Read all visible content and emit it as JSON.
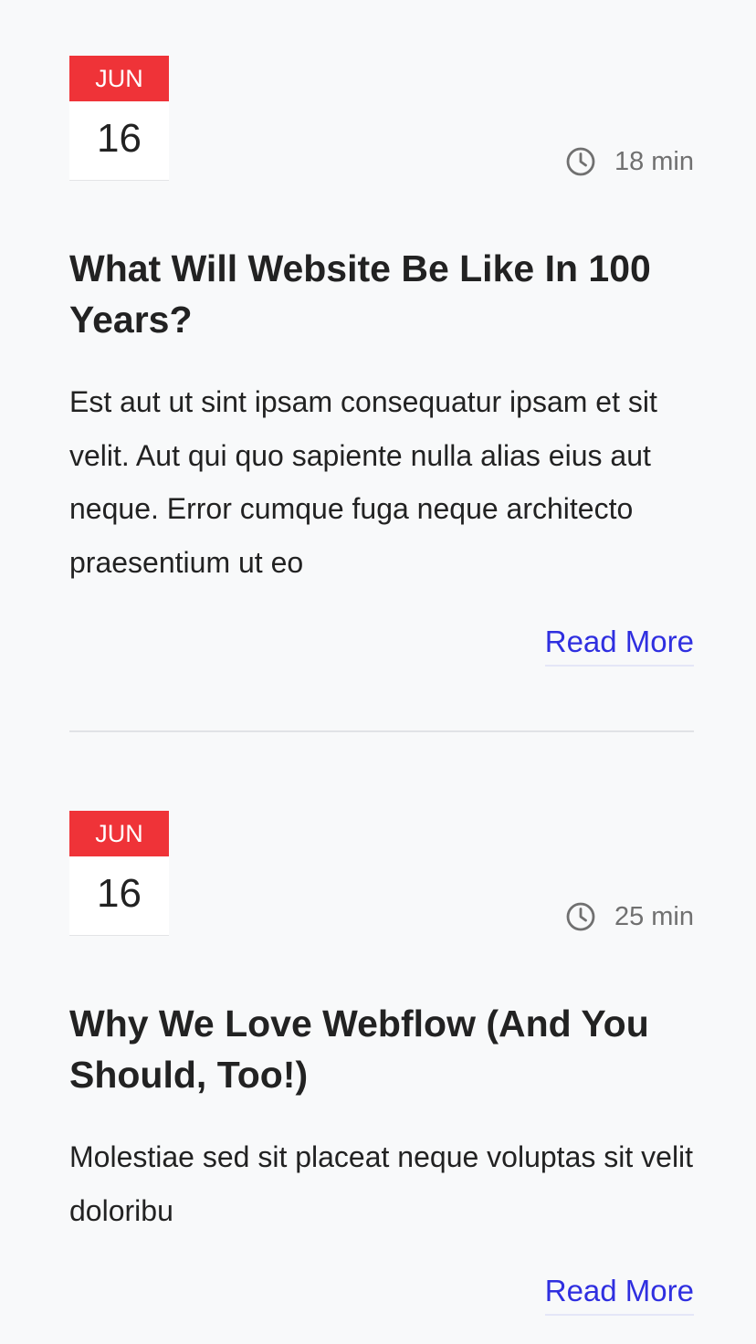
{
  "posts": [
    {
      "month": "JUN",
      "day": "16",
      "read_time": "18 min",
      "title": "What Will Website Be Like In 100 Years?",
      "excerpt": "Est aut ut sint ipsam consequatur ipsam et sit velit. Aut qui quo sapiente nulla alias eius aut neque. Error cumque fuga neque architecto praesentium ut eo",
      "read_more": "Read More",
      "clock_icon": "clock-icon"
    },
    {
      "month": "JUN",
      "day": "16",
      "read_time": "25 min",
      "title": "Why We Love Webflow (And You Should, Too!)",
      "excerpt": "Molestiae sed sit placeat neque voluptas sit velit doloribu",
      "read_more": "Read More",
      "clock_icon": "clock-icon"
    }
  ],
  "colors": {
    "background": "#f8f9fa",
    "month_badge": "#ef3338",
    "link": "#2f2fe0",
    "muted_text": "#707070",
    "divider": "#e1e3e6"
  }
}
